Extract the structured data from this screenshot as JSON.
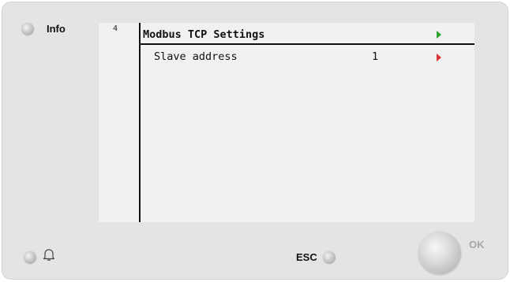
{
  "panel": {
    "info_label": "Info",
    "esc_label": "ESC",
    "ok_label": "OK"
  },
  "screen": {
    "page_number": "4",
    "title": "Modbus TCP Settings",
    "rows": [
      {
        "label": "Slave address",
        "value": "1"
      }
    ]
  },
  "colors": {
    "nav_arrow_title": "#2fa12f",
    "nav_arrow_row": "#e0322f"
  },
  "icons": {
    "title_arrow": "play-arrow-icon",
    "row_arrow": "play-arrow-icon",
    "alarm": "bell-icon"
  }
}
